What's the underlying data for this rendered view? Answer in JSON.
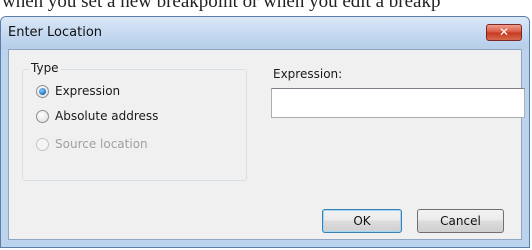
{
  "background": {
    "partial_text": "when you set a new breakpoint or when you edit a breakp"
  },
  "dialog": {
    "title": "Enter Location",
    "close_label": "✕",
    "type_group": {
      "legend": "Type",
      "options": [
        {
          "label": "Expression",
          "checked": true,
          "disabled": false
        },
        {
          "label": "Absolute address",
          "checked": false,
          "disabled": false
        },
        {
          "label": "Source location",
          "checked": false,
          "disabled": true
        }
      ]
    },
    "expression": {
      "label": "Expression:",
      "value": "",
      "placeholder": ""
    },
    "buttons": {
      "ok_label": "OK",
      "cancel_label": "Cancel"
    }
  },
  "colors": {
    "frame": "#bcd3ee",
    "client": "#f0f0f0",
    "close_button": "#d9533a",
    "default_button_border": "#3c7fb1"
  }
}
